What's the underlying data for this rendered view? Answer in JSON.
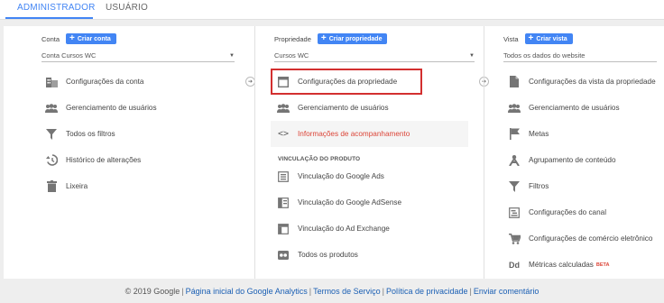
{
  "tabs": {
    "admin": "ADMINISTRADOR",
    "user": "USUÁRIO"
  },
  "account": {
    "header": "Conta",
    "create": "Criar conta",
    "selected": "Conta Cursos WC",
    "items": [
      {
        "label": "Configurações da conta",
        "icon": "building-icon"
      },
      {
        "label": "Gerenciamento de usuários",
        "icon": "users-icon"
      },
      {
        "label": "Todos os filtros",
        "icon": "filter-icon"
      },
      {
        "label": "Histórico de alterações",
        "icon": "history-icon"
      },
      {
        "label": "Lixeira",
        "icon": "trash-icon"
      }
    ]
  },
  "property": {
    "header": "Propriedade",
    "create": "Criar propriedade",
    "selected": "Cursos WC",
    "items": [
      {
        "label": "Configurações da propriedade",
        "icon": "window-icon"
      },
      {
        "label": "Gerenciamento de usuários",
        "icon": "users-icon"
      },
      {
        "label": "Informações de acompanhamento",
        "icon": "code-icon"
      }
    ],
    "section": "VINCULAÇÃO DO PRODUTO",
    "links": [
      {
        "label": "Vinculação do Google Ads",
        "icon": "ads-icon"
      },
      {
        "label": "Vinculação do Google AdSense",
        "icon": "adsense-icon"
      },
      {
        "label": "Vinculação do Ad Exchange",
        "icon": "adexchange-icon"
      },
      {
        "label": "Todos os produtos",
        "icon": "products-icon"
      }
    ]
  },
  "view": {
    "header": "Vista",
    "create": "Criar vista",
    "selected": "Todos os dados do website",
    "items": [
      {
        "label": "Configurações da vista da propriedade",
        "icon": "document-icon"
      },
      {
        "label": "Gerenciamento de usuários",
        "icon": "users-icon"
      },
      {
        "label": "Metas",
        "icon": "flag-icon"
      },
      {
        "label": "Agrupamento de conteúdo",
        "icon": "grouping-icon"
      },
      {
        "label": "Filtros",
        "icon": "filter-icon"
      },
      {
        "label": "Configurações do canal",
        "icon": "channel-icon"
      },
      {
        "label": "Configurações de comércio eletrônico",
        "icon": "cart-icon"
      },
      {
        "label": "Métricas calculadas",
        "icon": "dd-icon",
        "badge": "BETA"
      }
    ]
  },
  "footer": {
    "copyright": "© 2019 Google",
    "links": [
      "Página inicial do Google Analytics",
      "Termos de Serviço",
      "Política de privacidade",
      "Enviar comentário"
    ]
  },
  "colors": {
    "accent": "#4285f4",
    "active": "#db4437",
    "highlight": "#d32f2f"
  }
}
